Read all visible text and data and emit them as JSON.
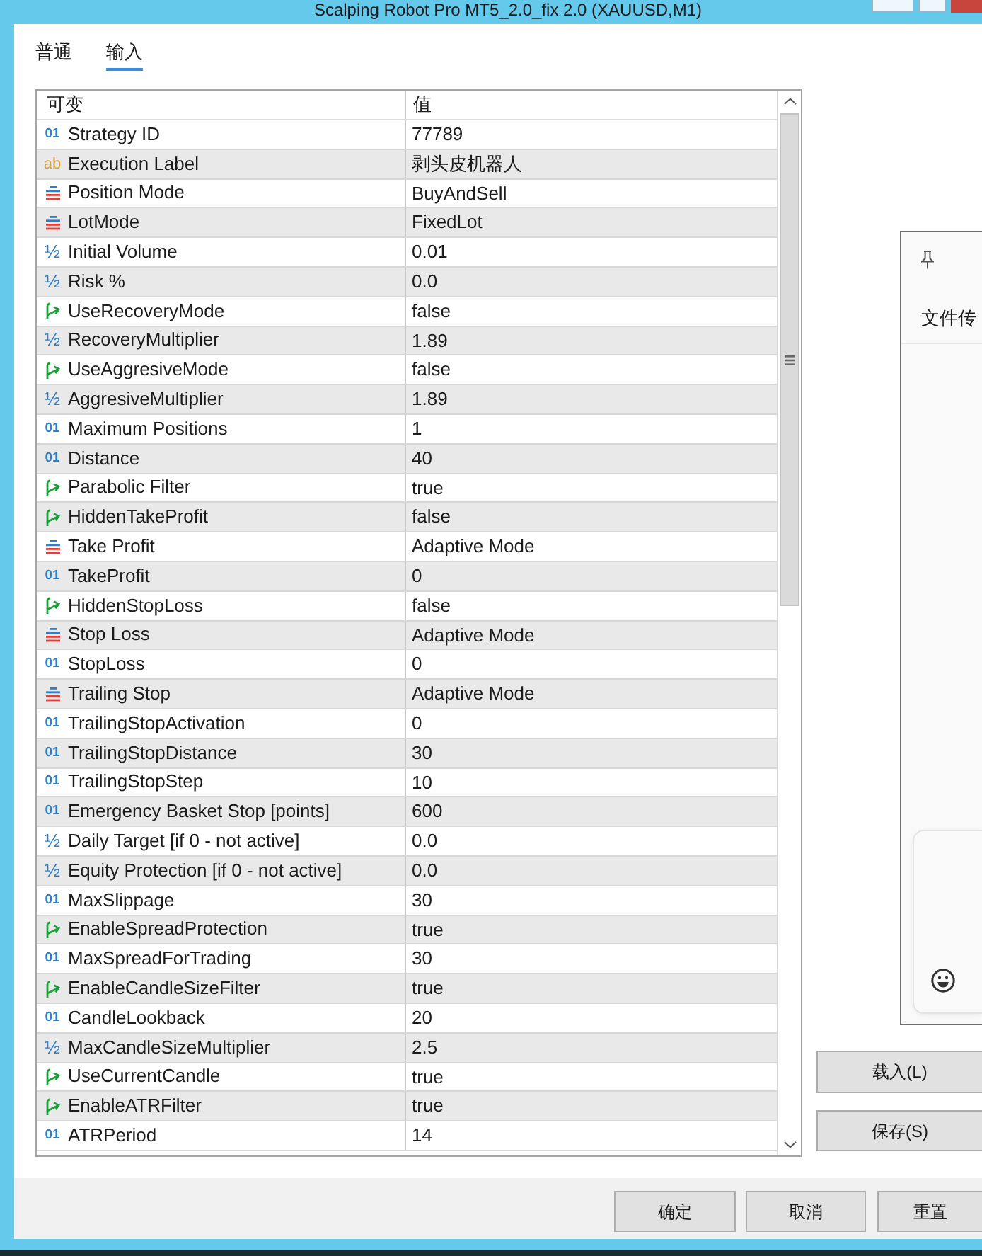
{
  "window": {
    "title": "Scalping Robot Pro MT5_2.0_fix 2.0 (XAUUSD,M1)"
  },
  "tabs": [
    {
      "label": "普通",
      "selected": false
    },
    {
      "label": "输入",
      "selected": true
    }
  ],
  "table": {
    "columns": [
      "可变",
      "值"
    ],
    "rows": [
      {
        "kind": "int",
        "symbol": "01",
        "name": "Strategy ID",
        "value": "77789"
      },
      {
        "kind": "string",
        "symbol": "ab",
        "name": "Execution Label",
        "value": "剥头皮机器人"
      },
      {
        "kind": "enum",
        "name": "Position Mode",
        "value": "BuyAndSell"
      },
      {
        "kind": "enum",
        "name": "LotMode",
        "value": "FixedLot"
      },
      {
        "kind": "double",
        "symbol": "½",
        "name": "Initial Volume",
        "value": "0.01"
      },
      {
        "kind": "double",
        "symbol": "½",
        "name": "Risk %",
        "value": "0.0"
      },
      {
        "kind": "bool",
        "name": "UseRecoveryMode",
        "value": "false"
      },
      {
        "kind": "double",
        "symbol": "½",
        "name": "RecoveryMultiplier",
        "value": "1.89"
      },
      {
        "kind": "bool",
        "name": "UseAggresiveMode",
        "value": "false"
      },
      {
        "kind": "double",
        "symbol": "½",
        "name": "AggresiveMultiplier",
        "value": "1.89"
      },
      {
        "kind": "int",
        "symbol": "01",
        "name": "Maximum Positions",
        "value": "1"
      },
      {
        "kind": "int",
        "symbol": "01",
        "name": "Distance",
        "value": "40"
      },
      {
        "kind": "bool",
        "name": "Parabolic Filter",
        "value": "true"
      },
      {
        "kind": "bool",
        "name": "HiddenTakeProfit",
        "value": "false"
      },
      {
        "kind": "enum",
        "name": "Take Profit",
        "value": "Adaptive Mode"
      },
      {
        "kind": "int",
        "symbol": "01",
        "name": "TakeProfit",
        "value": "0"
      },
      {
        "kind": "bool",
        "name": "HiddenStopLoss",
        "value": "false"
      },
      {
        "kind": "enum",
        "name": "Stop Loss",
        "value": "Adaptive Mode"
      },
      {
        "kind": "int",
        "symbol": "01",
        "name": "StopLoss",
        "value": "0"
      },
      {
        "kind": "enum",
        "name": "Trailing Stop",
        "value": "Adaptive Mode"
      },
      {
        "kind": "int",
        "symbol": "01",
        "name": "TrailingStopActivation",
        "value": "0"
      },
      {
        "kind": "int",
        "symbol": "01",
        "name": "TrailingStopDistance",
        "value": "30"
      },
      {
        "kind": "int",
        "symbol": "01",
        "name": "TrailingStopStep",
        "value": "10"
      },
      {
        "kind": "int",
        "symbol": "01",
        "name": "Emergency Basket Stop [points]",
        "value": "600"
      },
      {
        "kind": "double",
        "symbol": "½",
        "name": "Daily Target [if 0 - not active]",
        "value": "0.0"
      },
      {
        "kind": "double",
        "symbol": "½",
        "name": "Equity Protection [if 0 - not active]",
        "value": "0.0"
      },
      {
        "kind": "int",
        "symbol": "01",
        "name": "MaxSlippage",
        "value": "30"
      },
      {
        "kind": "bool",
        "name": "EnableSpreadProtection",
        "value": "true"
      },
      {
        "kind": "int",
        "symbol": "01",
        "name": "MaxSpreadForTrading",
        "value": "30"
      },
      {
        "kind": "bool",
        "name": "EnableCandleSizeFilter",
        "value": "true"
      },
      {
        "kind": "int",
        "symbol": "01",
        "name": "CandleLookback",
        "value": "20"
      },
      {
        "kind": "double",
        "symbol": "½",
        "name": "MaxCandleSizeMultiplier",
        "value": "2.5"
      },
      {
        "kind": "bool",
        "name": "UseCurrentCandle",
        "value": "true"
      },
      {
        "kind": "bool",
        "name": "EnableATRFilter",
        "value": "true"
      },
      {
        "kind": "int",
        "symbol": "01",
        "name": "ATRPeriod",
        "value": "14"
      }
    ]
  },
  "side_panel": {
    "title": "文件传"
  },
  "side_buttons": [
    "载入(L)",
    "保存(S)"
  ],
  "footer_buttons": [
    "确定",
    "取消",
    "重置"
  ]
}
